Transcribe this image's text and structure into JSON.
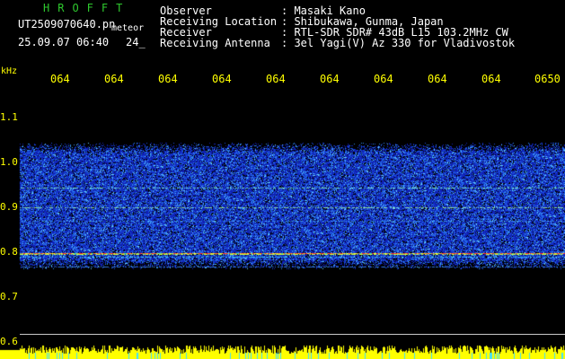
{
  "header": {
    "brand": "HROFFT",
    "filename": "UT2509070640.pn",
    "meteor_label": "meteor",
    "timestamp": "25.09.07 06:40",
    "count": "24_"
  },
  "info": [
    {
      "label": "Observer",
      "value": ": Masaki Kano"
    },
    {
      "label": "Receiving Location",
      "value": ": Shibukawa, Gunma, Japan"
    },
    {
      "label": "Receiver",
      "value": ": RTL-SDR SDR# 43dB L15 103.2MHz CW"
    },
    {
      "label": "Receiving Antenna",
      "value": ": 3el Yagi(V) Az 330 for Vladivostok"
    }
  ],
  "axis": {
    "unit": "kHz",
    "time_ticks": [
      "064",
      "064",
      "064",
      "064",
      "064",
      "064",
      "064",
      "064",
      "064",
      "0650"
    ],
    "freq_ticks": [
      "1.1",
      "1.0",
      "0.9",
      "0.8",
      "0.7",
      "0.6"
    ]
  },
  "colors": {
    "background": "#000000",
    "axis_text": "#ffff00",
    "brand": "#2ec82e",
    "info_text": "#ffffff",
    "noise_dark": "#1a2ac8",
    "noise_light": "#3ca0ff",
    "signal_hot": "#ff2a2a",
    "signal_warm": "#ffff00",
    "bottom_bar": "#ffff00"
  }
}
